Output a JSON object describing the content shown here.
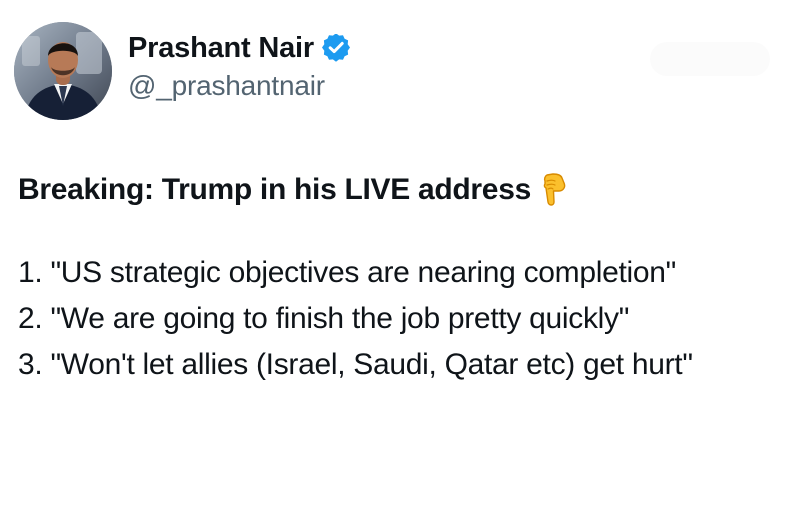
{
  "author": {
    "display_name": "Prashant Nair",
    "handle": "@_prashantnair",
    "verified": true,
    "verified_color": "#1d9bf0"
  },
  "tweet": {
    "headline": "Breaking: Trump in his LIVE address",
    "headline_icon": "backhand-index-pointing-down-icon",
    "points": [
      "1. \"US strategic objectives are nearing completion\"",
      "2. \"We are going to finish the job pretty quickly\"",
      "3. \"Won't let allies (Israel, Saudi, Qatar etc) get hurt\""
    ]
  },
  "colors": {
    "text": "#0f1419",
    "secondary_text": "#536471"
  }
}
